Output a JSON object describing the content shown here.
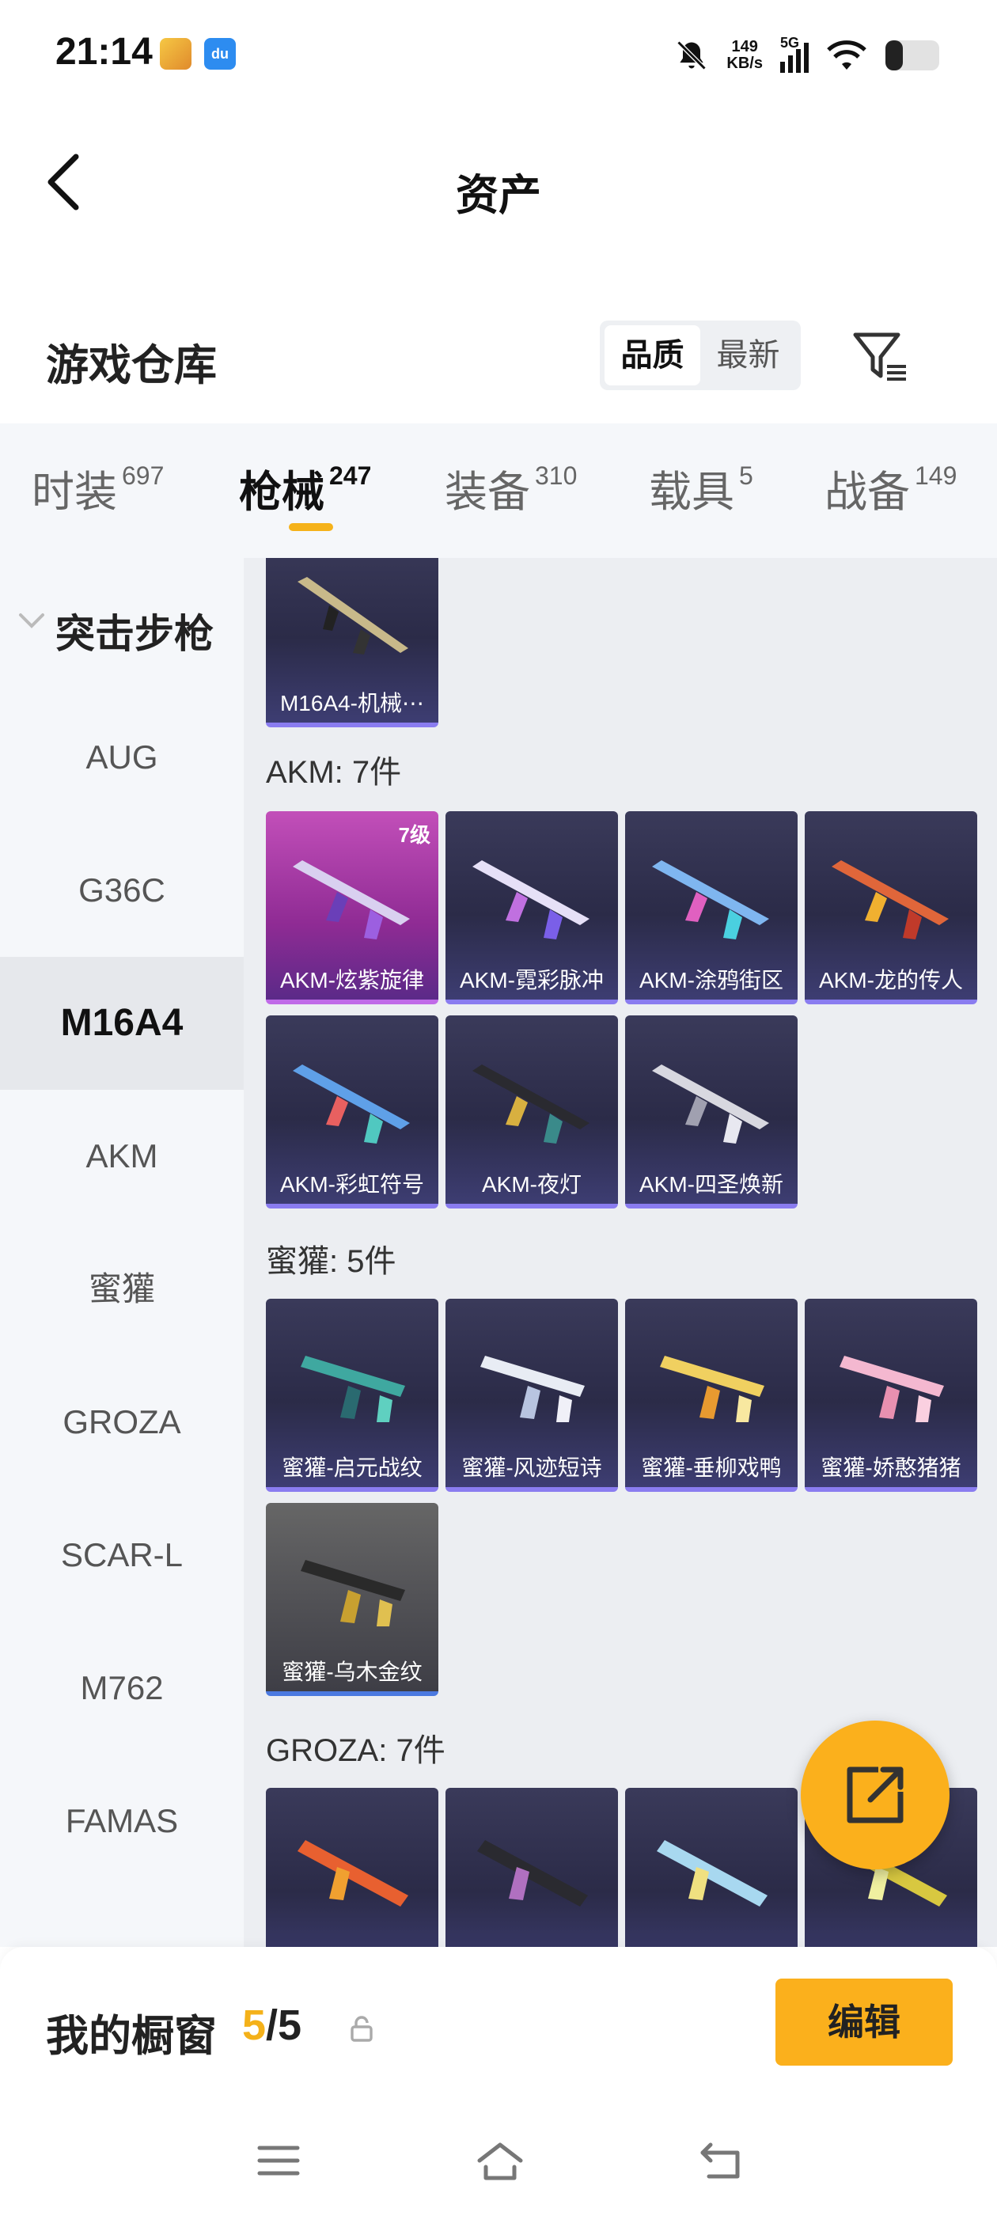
{
  "status_bar": {
    "time": "21:14",
    "app_icon_1": "game-app-icon",
    "app_icon_2_label": "du",
    "net_speed_value": "149",
    "net_speed_unit": "KB/s",
    "network_type": "5G",
    "icons": [
      "mute-bell-icon",
      "signal-icon",
      "wifi-icon",
      "battery-icon"
    ]
  },
  "header": {
    "title": "资产",
    "back_icon": "chevron-left-icon"
  },
  "warehouse": {
    "title": "游戏仓库",
    "sort_options": [
      "品质",
      "最新"
    ],
    "sort_selected": "品质",
    "filter_icon": "filter-icon"
  },
  "tabs": [
    {
      "label": "时装",
      "count": "697"
    },
    {
      "label": "枪械",
      "count": "247",
      "active": true
    },
    {
      "label": "装备",
      "count": "310"
    },
    {
      "label": "载具",
      "count": "5"
    },
    {
      "label": "战备",
      "count": "149"
    }
  ],
  "sidebar": {
    "group_label": "突击步枪",
    "items": [
      "AUG",
      "G36C",
      "M16A4",
      "AKM",
      "蜜獾",
      "GROZA",
      "SCAR-L",
      "M762",
      "FAMAS"
    ],
    "selected": "M16A4"
  },
  "content": {
    "partial_card": {
      "name": "M16A4-机械⋯"
    },
    "sections": [
      {
        "header": "AKM: 7件",
        "cards": [
          {
            "name": "AKM-炫紫旋律",
            "badge": "7级",
            "style": "pink"
          },
          {
            "name": "AKM-霓彩脉冲"
          },
          {
            "name": "AKM-涂鸦街区"
          },
          {
            "name": "AKM-龙的传人"
          },
          {
            "name": "AKM-彩虹符号"
          },
          {
            "name": "AKM-夜灯"
          },
          {
            "name": "AKM-四圣焕新"
          }
        ]
      },
      {
        "header": "蜜獾: 5件",
        "cards": [
          {
            "name": "蜜獾-启元战纹"
          },
          {
            "name": "蜜獾-风迹短诗"
          },
          {
            "name": "蜜獾-垂柳戏鸭"
          },
          {
            "name": "蜜獾-娇憨猪猪"
          },
          {
            "name": "蜜獾-乌木金纹",
            "style": "gray"
          }
        ]
      },
      {
        "header": "GROZA: 7件",
        "cards": [
          {
            "name": ""
          },
          {
            "name": ""
          },
          {
            "name": ""
          },
          {
            "name": ""
          }
        ]
      }
    ]
  },
  "fab": {
    "icon": "share-external-icon"
  },
  "bottom_bar": {
    "shelf_label": "我的橱窗",
    "shelf_current": "5",
    "shelf_total": "/5",
    "lock_icon": "lock-icon",
    "edit_label": "编辑"
  },
  "nav_bar": {
    "icons": [
      "menu-icon",
      "home-icon",
      "back-icon"
    ]
  },
  "colors": {
    "accent": "#fbb01c",
    "card_bg": "#2b2b48",
    "card_border": "#8a7cf0",
    "highlight_card": "#c24fb9"
  }
}
